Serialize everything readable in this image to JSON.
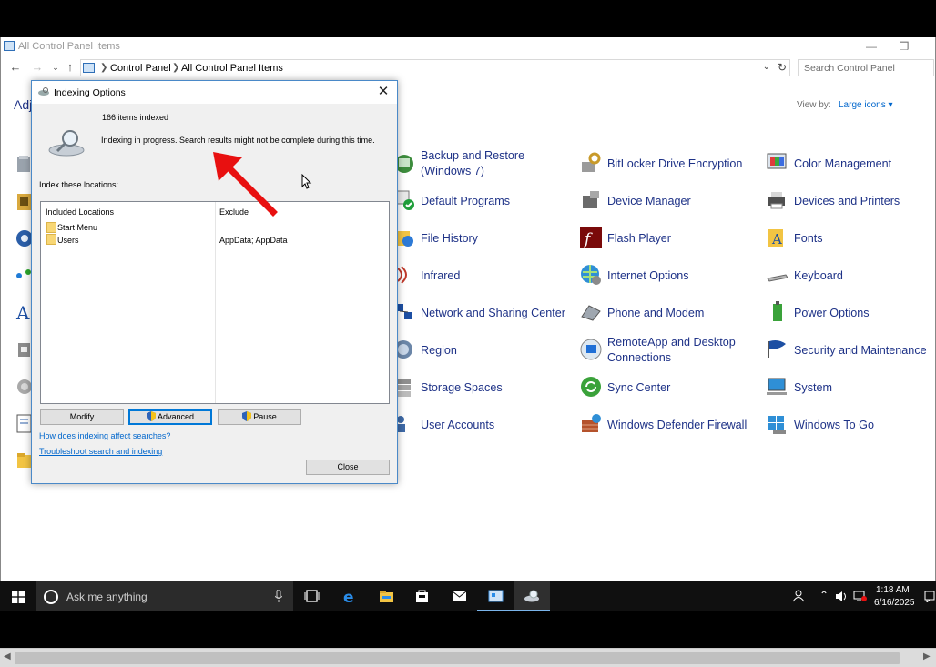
{
  "control_panel": {
    "title": "All Control Panel Items",
    "breadcrumb": [
      "Control Panel",
      "All Control Panel Items"
    ],
    "search_placeholder": "Search Control Panel",
    "adjust_heading": "Adj",
    "view_by_label": "View by:",
    "view_by_value": "Large icons",
    "items": [
      {
        "label": "Backup and Restore (Windows 7)",
        "icon": "backup-restore-icon"
      },
      {
        "label": "BitLocker Drive Encryption",
        "icon": "bitlocker-icon"
      },
      {
        "label": "Color Management",
        "icon": "color-management-icon"
      },
      {
        "label": "Default Programs",
        "icon": "default-programs-icon"
      },
      {
        "label": "Device Manager",
        "icon": "device-manager-icon"
      },
      {
        "label": "Devices and Printers",
        "icon": "devices-printers-icon"
      },
      {
        "label": "File History",
        "icon": "file-history-icon"
      },
      {
        "label": "Flash Player",
        "icon": "flash-player-icon"
      },
      {
        "label": "Fonts",
        "icon": "fonts-icon"
      },
      {
        "label": "Infrared",
        "icon": "infrared-icon"
      },
      {
        "label": "Internet Options",
        "icon": "internet-options-icon"
      },
      {
        "label": "Keyboard",
        "icon": "keyboard-icon"
      },
      {
        "label": "Network and Sharing Center",
        "icon": "network-sharing-icon"
      },
      {
        "label": "Phone and Modem",
        "icon": "phone-modem-icon"
      },
      {
        "label": "Power Options",
        "icon": "power-options-icon"
      },
      {
        "label": "Region",
        "icon": "region-icon"
      },
      {
        "label": "RemoteApp and Desktop Connections",
        "icon": "remoteapp-icon"
      },
      {
        "label": "Security and Maintenance",
        "icon": "security-maintenance-icon"
      },
      {
        "label": "Storage Spaces",
        "icon": "storage-spaces-icon"
      },
      {
        "label": "Sync Center",
        "icon": "sync-center-icon"
      },
      {
        "label": "System",
        "icon": "system-icon"
      },
      {
        "label": "User Accounts",
        "icon": "user-accounts-icon"
      },
      {
        "label": "Windows Defender Firewall",
        "icon": "firewall-icon"
      },
      {
        "label": "Windows To Go",
        "icon": "windows-to-go-icon"
      }
    ]
  },
  "dialog": {
    "title": "Indexing Options",
    "items_indexed": "166 items indexed",
    "status": "Indexing in progress. Search results might not be complete during this time.",
    "index_locations_label": "Index these locations:",
    "col_included": "Included Locations",
    "col_exclude": "Exclude",
    "locations": [
      {
        "name": "Start Menu",
        "exclude": ""
      },
      {
        "name": "Users",
        "exclude": "AppData; AppData"
      }
    ],
    "btn_modify": "Modify",
    "btn_advanced": "Advanced",
    "btn_pause": "Pause",
    "link_how": "How does indexing affect searches?",
    "link_troubleshoot": "Troubleshoot search and indexing",
    "btn_close": "Close"
  },
  "taskbar": {
    "search_placeholder": "Ask me anything",
    "time": "1:18 AM",
    "date": "6/16/2025"
  },
  "colors": {
    "link_blue": "#1e3287",
    "accent": "#0078d7",
    "arrow_red": "#e81010"
  }
}
